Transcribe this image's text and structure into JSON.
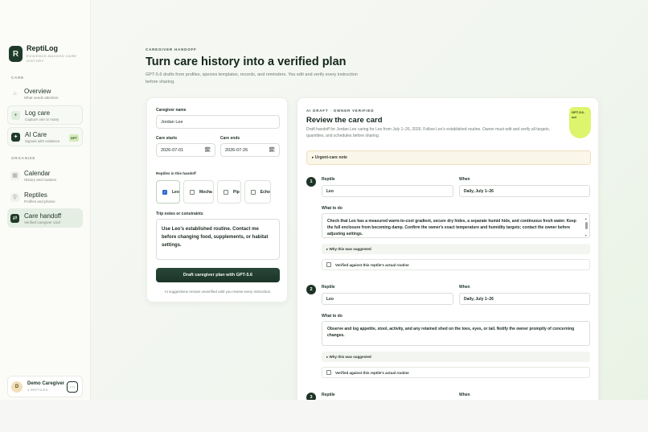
{
  "sidebar": {
    "brand_name": "ReptiLog",
    "brand_sub": "EVIDENCE-BACKED CARE HISTORY",
    "brand_mark": "R",
    "section_care": "CARE",
    "section_organize": "ORGANIZE",
    "items": [
      {
        "title": "Overview",
        "desc": "What needs attention",
        "icon": "⌂"
      },
      {
        "title": "Log care",
        "desc": "Capture one or many",
        "icon": "+"
      },
      {
        "title": "AI Care",
        "desc": "Signals with evidence",
        "icon": "✦",
        "badge": "GPT"
      },
      {
        "title": "Calendar",
        "desc": "History and routines",
        "icon": "▦"
      },
      {
        "title": "Reptiles",
        "desc": "Profiles and photos",
        "icon": "⚲"
      },
      {
        "title": "Care handoff",
        "desc": "Verified caregiver card",
        "icon": "⇄"
      }
    ],
    "user": {
      "initial": "D",
      "name": "Demo Caregiver",
      "sub": "4 REPTILES",
      "more": "···"
    }
  },
  "header": {
    "eyebrow": "CAREGIVER HANDOFF",
    "title": "Turn care history into a verified plan",
    "subtitle": "GPT-5.6 drafts from profiles, species templates, records, and reminders. You edit and verify every instruction before sharing."
  },
  "form": {
    "caregiver_label": "Caregiver name",
    "caregiver_value": "Jordan Lee",
    "starts_label": "Care starts",
    "starts_value": "2026-07-01",
    "ends_label": "Care ends",
    "ends_value": "2026-07-26",
    "reptiles_label": "Reptiles in this handoff",
    "reptiles": [
      {
        "name": "Leo",
        "checked": true
      },
      {
        "name": "Mocha",
        "checked": false
      },
      {
        "name": "Pip",
        "checked": false
      },
      {
        "name": "Echo",
        "checked": false
      }
    ],
    "notes_label": "Trip notes or constraints",
    "notes_value": "Use Leo's established routine. Contact me before changing food, supplements, or habitat settings.",
    "button_label": "Draft caregiver plan with GPT-5.6",
    "hint": "AI suggestions remain unverified until you review every instruction.",
    "calendar_icon": "🗓"
  },
  "review": {
    "eyebrow": "AI DRAFT · OWNER VERIFIED",
    "title": "Review the care card",
    "subtitle": "Draft handoff for Jordan Lee caring for Leo from July 1–26, 2026. Follow Leo's established routine. Owner must edit and verify all targets, quantities, and schedules before sharing.",
    "bubble": "GPT-5.6-sol",
    "urgent": "▸ Urgent-care note",
    "reptile_label": "Reptile",
    "when_label": "When",
    "what_label": "What to do",
    "why_label": "▸ Why this was suggested",
    "verify_label": "Verified against this reptile's actual routine",
    "steps": [
      {
        "num": "1",
        "reptile": "Leo",
        "when": "Daily, July 1–26",
        "what": "Check that Leo has a measured warm-to-cool gradient, secure dry hides, a separate humid hide, and continuous fresh water. Keep the full enclosure from becoming damp. Confirm the owner's exact temperature and humidity targets; contact the owner before adjusting settings."
      },
      {
        "num": "2",
        "reptile": "Leo",
        "when": "Daily, July 1–26",
        "what": "Observe and log appetite, stool, activity, and any retained shed on the toes, eyes, or tail. Notify the owner promptly of concerning changes."
      },
      {
        "num": "3"
      }
    ]
  }
}
